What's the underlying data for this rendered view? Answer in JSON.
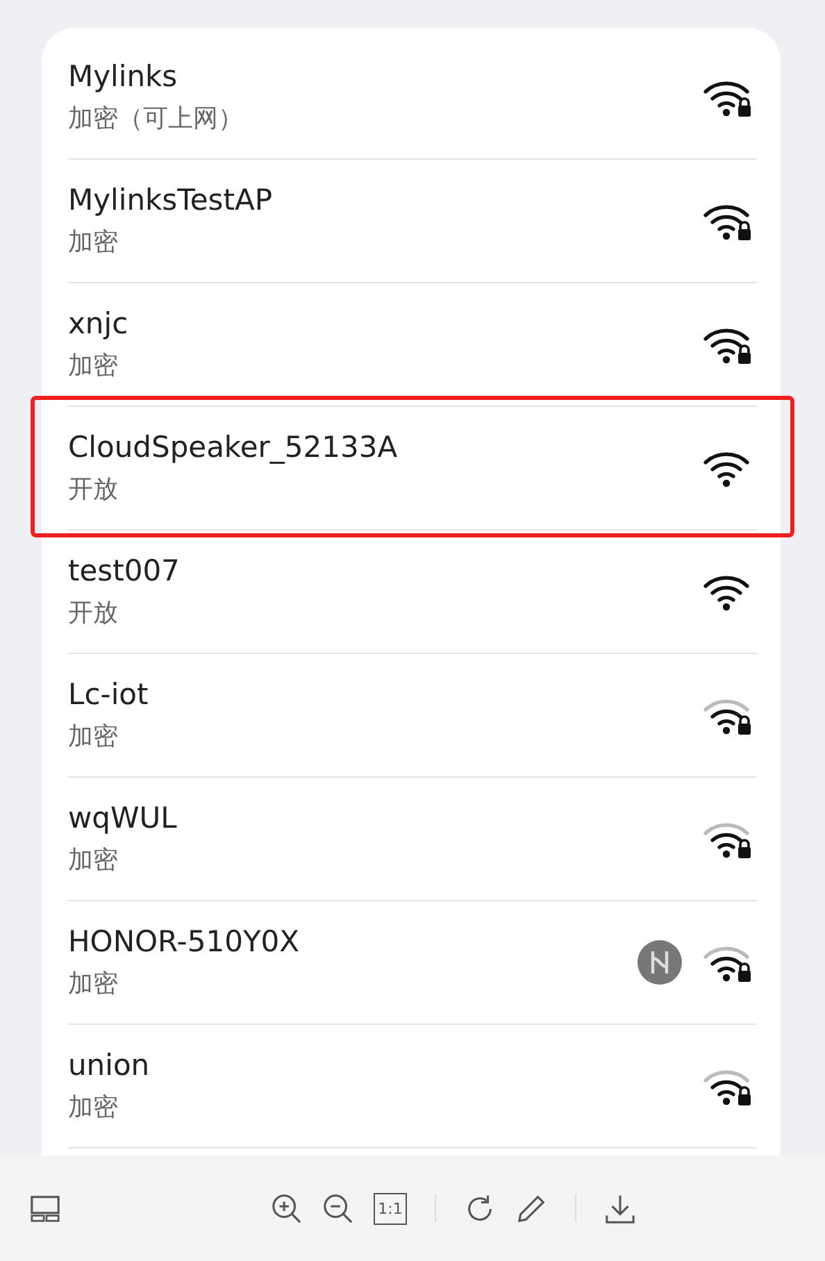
{
  "networks": [
    {
      "name": "Mylinks",
      "security": "加密（可上网）",
      "secured": true,
      "strong": true,
      "highlighted": false,
      "hilink": false
    },
    {
      "name": "MylinksTestAP",
      "security": "加密",
      "secured": true,
      "strong": true,
      "highlighted": false,
      "hilink": false
    },
    {
      "name": "xnjc",
      "security": "加密",
      "secured": true,
      "strong": true,
      "highlighted": false,
      "hilink": false
    },
    {
      "name": "CloudSpeaker_52133A",
      "security": "开放",
      "secured": false,
      "strong": true,
      "highlighted": true,
      "hilink": false
    },
    {
      "name": "test007",
      "security": "开放",
      "secured": false,
      "strong": true,
      "highlighted": false,
      "hilink": false
    },
    {
      "name": "Lc-iot",
      "security": "加密",
      "secured": true,
      "strong": false,
      "highlighted": false,
      "hilink": false
    },
    {
      "name": "wqWUL",
      "security": "加密",
      "secured": true,
      "strong": false,
      "highlighted": false,
      "hilink": false
    },
    {
      "name": "HONOR-510Y0X",
      "security": "加密",
      "secured": true,
      "strong": false,
      "highlighted": false,
      "hilink": true
    },
    {
      "name": "union",
      "security": "加密",
      "secured": true,
      "strong": false,
      "highlighted": false,
      "hilink": false
    }
  ],
  "toolbar": {
    "actual_size_label": "1:1"
  }
}
